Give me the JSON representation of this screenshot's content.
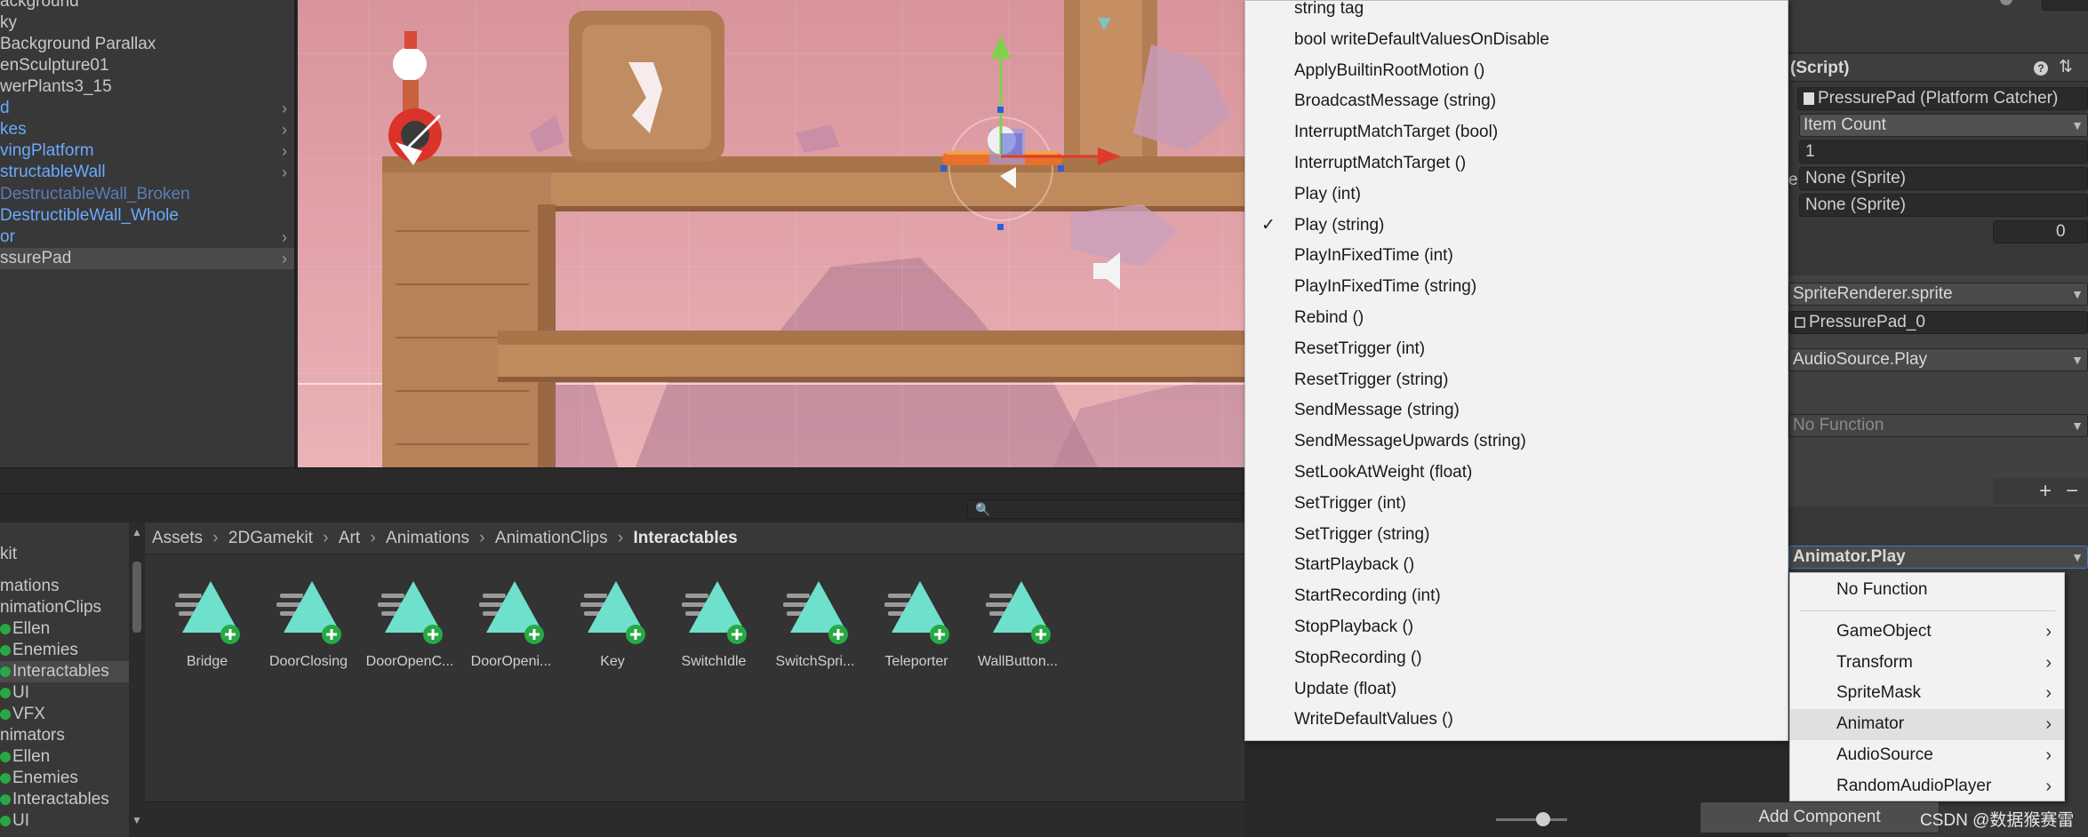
{
  "hierarchy": {
    "items": [
      {
        "label": "ackground",
        "chevron": false,
        "color": "#c8c8c8",
        "selected": false
      },
      {
        "label": "ky",
        "chevron": false,
        "color": "#c8c8c8",
        "selected": false
      },
      {
        "label": "Background Parallax",
        "chevron": false,
        "color": "#c8c8c8",
        "selected": false
      },
      {
        "label": "enSculpture01",
        "chevron": false,
        "color": "#c8c8c8",
        "selected": false
      },
      {
        "label": "werPlants3_15",
        "chevron": false,
        "color": "#c8c8c8",
        "selected": false
      },
      {
        "label": "d",
        "chevron": true,
        "color": "#6aa9ff",
        "selected": false
      },
      {
        "label": "kes",
        "chevron": true,
        "color": "#6aa9ff",
        "selected": false
      },
      {
        "label": "vingPlatform",
        "chevron": true,
        "color": "#6aa9ff",
        "selected": false
      },
      {
        "label": "structableWall",
        "chevron": true,
        "color": "#6aa9ff",
        "selected": false
      },
      {
        "label": "DestructableWall_Broken",
        "chevron": false,
        "color": "#5a7cb8",
        "selected": false
      },
      {
        "label": "DestructibleWall_Whole",
        "chevron": false,
        "color": "#6aa9ff",
        "selected": false
      },
      {
        "label": "or",
        "chevron": true,
        "color": "#6aa9ff",
        "selected": false
      },
      {
        "label": "ssurePad",
        "chevron": true,
        "color": "#c8c8c8",
        "selected": true
      }
    ]
  },
  "project": {
    "tree": [
      {
        "label": "kit",
        "dot": false,
        "selected": false
      },
      {
        "label": "mations",
        "dot": false,
        "selected": false
      },
      {
        "label": "nimationClips",
        "dot": false,
        "selected": false
      },
      {
        "label": "Ellen",
        "dot": true,
        "selected": false
      },
      {
        "label": "Enemies",
        "dot": true,
        "selected": false
      },
      {
        "label": "Interactables",
        "dot": true,
        "selected": true
      },
      {
        "label": "UI",
        "dot": true,
        "selected": false
      },
      {
        "label": "VFX",
        "dot": true,
        "selected": false
      },
      {
        "label": "nimators",
        "dot": false,
        "selected": false
      },
      {
        "label": "Ellen",
        "dot": true,
        "selected": false
      },
      {
        "label": "Enemies",
        "dot": true,
        "selected": false
      },
      {
        "label": "Interactables",
        "dot": true,
        "selected": false
      },
      {
        "label": "UI",
        "dot": true,
        "selected": false
      }
    ],
    "breadcrumb": [
      "Assets",
      "2DGamekit",
      "Art",
      "Animations",
      "AnimationClips",
      "Interactables"
    ],
    "assets": [
      "Bridge",
      "DoorClosing",
      "DoorOpenC...",
      "DoorOpeni...",
      "Key",
      "SwitchIdle",
      "SwitchSpri...",
      "Teleporter",
      "WallButton..."
    ]
  },
  "menu": {
    "items": [
      {
        "label": "string tag",
        "checked": false
      },
      {
        "label": "bool writeDefaultValuesOnDisable",
        "checked": false
      },
      {
        "label": "ApplyBuiltinRootMotion ()",
        "checked": false
      },
      {
        "label": "BroadcastMessage (string)",
        "checked": false
      },
      {
        "label": "InterruptMatchTarget (bool)",
        "checked": false
      },
      {
        "label": "InterruptMatchTarget ()",
        "checked": false
      },
      {
        "label": "Play (int)",
        "checked": false
      },
      {
        "label": "Play (string)",
        "checked": true
      },
      {
        "label": "PlayInFixedTime (int)",
        "checked": false
      },
      {
        "label": "PlayInFixedTime (string)",
        "checked": false
      },
      {
        "label": "Rebind ()",
        "checked": false
      },
      {
        "label": "ResetTrigger (int)",
        "checked": false
      },
      {
        "label": "ResetTrigger (string)",
        "checked": false
      },
      {
        "label": "SendMessage (string)",
        "checked": false
      },
      {
        "label": "SendMessageUpwards (string)",
        "checked": false
      },
      {
        "label": "SetLookAtWeight (float)",
        "checked": false
      },
      {
        "label": "SetTrigger (int)",
        "checked": false
      },
      {
        "label": "SetTrigger (string)",
        "checked": false
      },
      {
        "label": "StartPlayback ()",
        "checked": false
      },
      {
        "label": "StartRecording (int)",
        "checked": false
      },
      {
        "label": "StopPlayback ()",
        "checked": false
      },
      {
        "label": "StopRecording ()",
        "checked": false
      },
      {
        "label": "Update (float)",
        "checked": false
      },
      {
        "label": "WriteDefaultValues ()",
        "checked": false
      }
    ],
    "checkmark": "✓"
  },
  "inspector": {
    "script_header": "(Script)",
    "script_field": "PressurePad (Platform Catcher)",
    "item_count_dd": "Item Count",
    "count_value": "1",
    "sprite_none_1": "None (Sprite)",
    "sprite_none_2": "None (Sprite)",
    "zero_value": "0",
    "sprite_renderer_dd": "SpriteRenderer.sprite",
    "pressure_pad_obj": "PressurePad_0",
    "audio_play_dd": "AudioSource.Play",
    "no_function_dd": "No Function",
    "plus": "+",
    "minus": "−",
    "animator_play_dd": "Animator.Play",
    "add_component": "Add Component",
    "label_e": "e"
  },
  "submenu": {
    "items": [
      {
        "label": "No Function",
        "chevron": false,
        "hover": false
      },
      {
        "label": "GameObject",
        "chevron": true,
        "hover": false
      },
      {
        "label": "Transform",
        "chevron": true,
        "hover": false
      },
      {
        "label": "SpriteMask",
        "chevron": true,
        "hover": false
      },
      {
        "label": "Animator",
        "chevron": true,
        "hover": true
      },
      {
        "label": "AudioSource",
        "chevron": true,
        "hover": false
      },
      {
        "label": "RandomAudioPlayer",
        "chevron": true,
        "hover": false
      }
    ]
  },
  "watermark": "CSDN @数据猴赛雷",
  "colors": {
    "prefab_blue": "#6aa9ff",
    "teal_clip": "#6fe0cc",
    "add_green": "#27a945"
  }
}
